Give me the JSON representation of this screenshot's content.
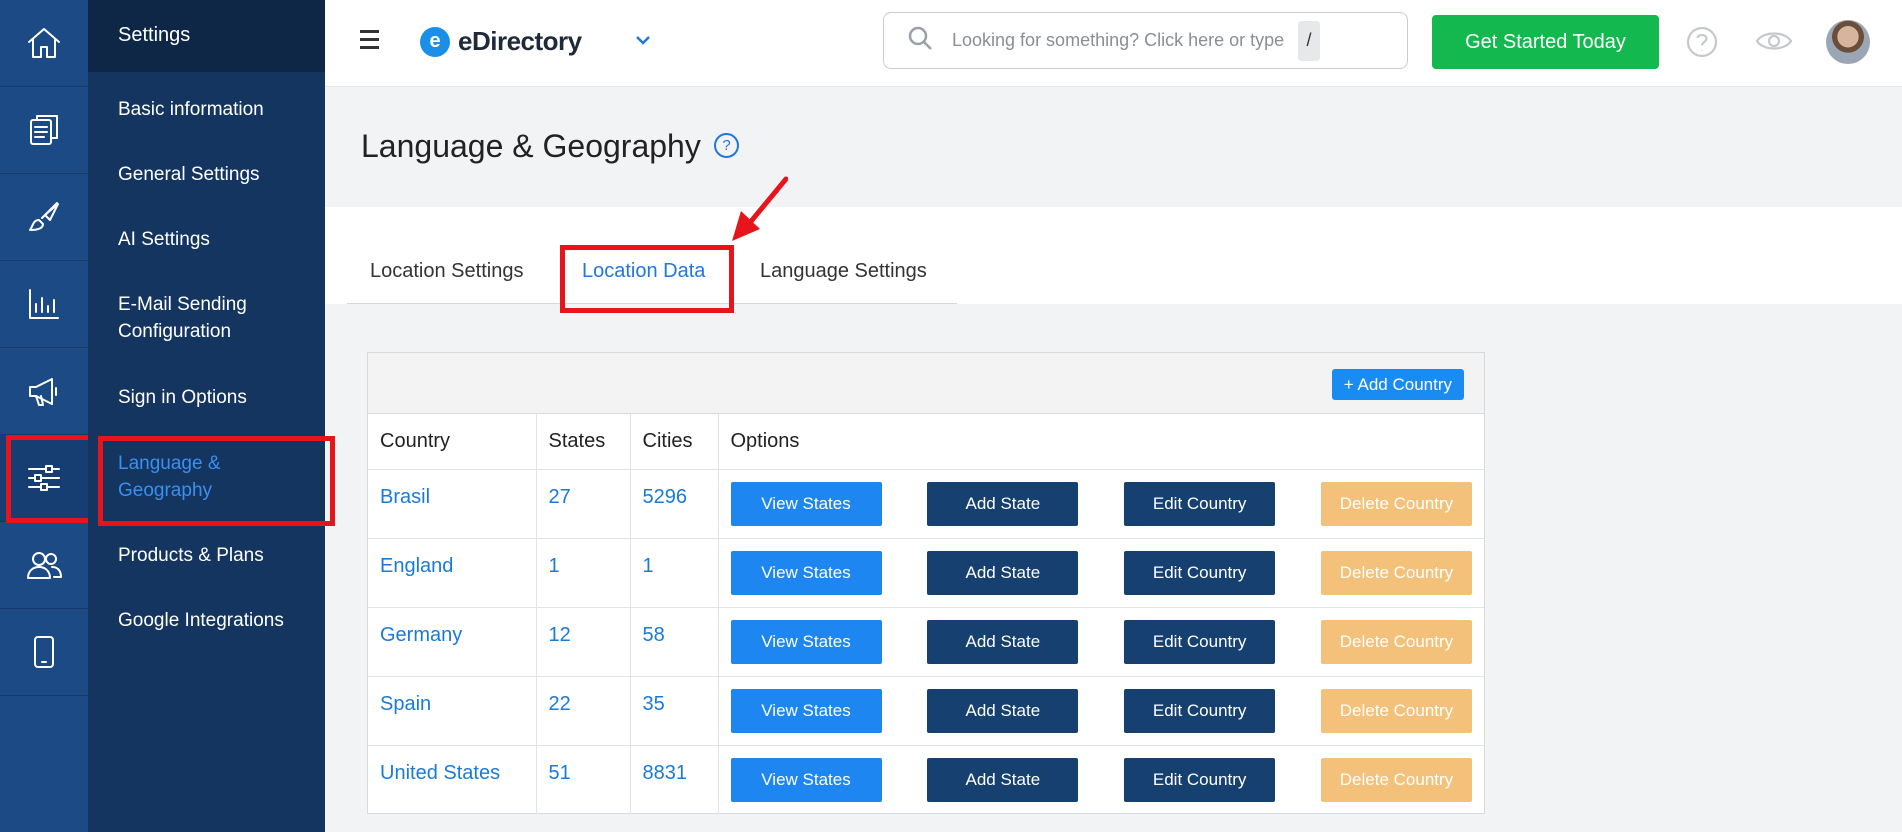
{
  "rail": {
    "items": [
      {
        "icon": "home-icon"
      },
      {
        "icon": "documents-icon"
      },
      {
        "icon": "brush-icon"
      },
      {
        "icon": "chart-icon"
      },
      {
        "icon": "megaphone-icon"
      },
      {
        "icon": "sliders-icon",
        "active": true
      },
      {
        "icon": "users-icon"
      },
      {
        "icon": "mobile-icon"
      }
    ]
  },
  "sidebar": {
    "header": "Settings",
    "items": [
      {
        "label": "Basic information"
      },
      {
        "label": "General Settings"
      },
      {
        "label": "AI Settings"
      },
      {
        "label": "E-Mail Sending Configuration"
      },
      {
        "label": "Sign in Options"
      },
      {
        "label": "Language & Geography",
        "active": true
      },
      {
        "label": "Products & Plans"
      },
      {
        "label": "Google Integrations"
      }
    ]
  },
  "header": {
    "logo_letter": "e",
    "logo_text": "eDirectory",
    "search_placeholder": "Looking for something? Click here or type",
    "search_shortcut": "/",
    "cta_label": "Get Started Today"
  },
  "page": {
    "title": "Language & Geography",
    "help_glyph": "?"
  },
  "tabs": [
    {
      "label": "Location Settings"
    },
    {
      "label": "Location Data",
      "active": true
    },
    {
      "label": "Language Settings"
    }
  ],
  "table": {
    "add_button": "+ Add Country",
    "columns": [
      "Country",
      "States",
      "Cities",
      "Options"
    ],
    "button_labels": {
      "view": "View States",
      "add": "Add State",
      "edit": "Edit Country",
      "delete": "Delete Country"
    },
    "rows": [
      {
        "country": "Brasil",
        "states": "27",
        "cities": "5296"
      },
      {
        "country": "England",
        "states": "1",
        "cities": "1"
      },
      {
        "country": "Germany",
        "states": "12",
        "cities": "58"
      },
      {
        "country": "Spain",
        "states": "22",
        "cities": "35"
      },
      {
        "country": "United States",
        "states": "51",
        "cities": "8831"
      }
    ]
  },
  "colors": {
    "rail_bg": "#1c4a85",
    "sidebar_bg": "#133560",
    "accent": "#2176e0",
    "cta": "#13b84f",
    "highlight": "#e8141b",
    "delete_button": "#f3c17a"
  }
}
